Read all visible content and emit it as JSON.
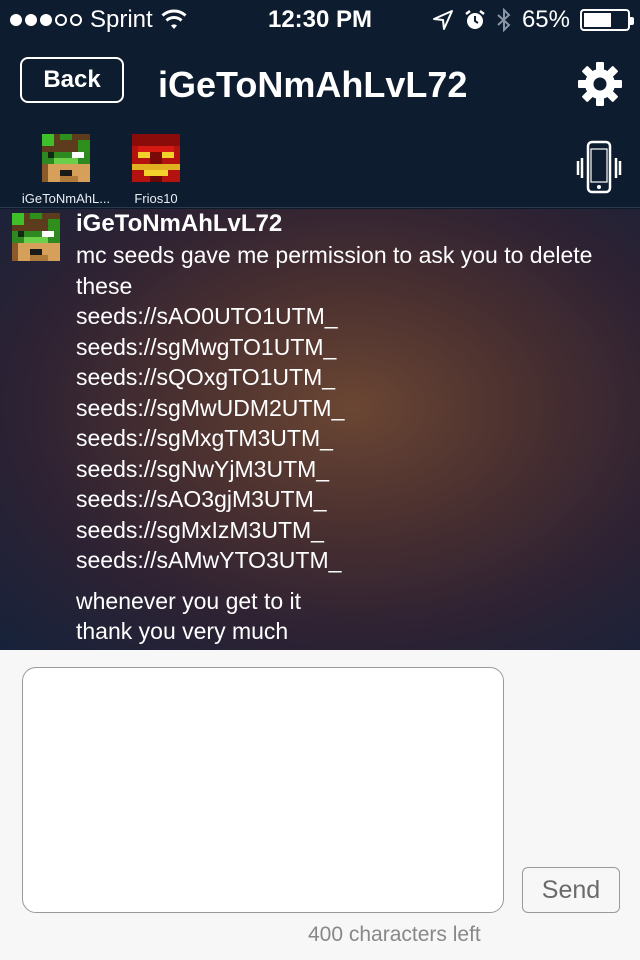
{
  "status_bar": {
    "carrier": "Sprint",
    "signal_bars_filled": 3,
    "signal_bars_total": 5,
    "time": "12:30 PM",
    "battery_percent": "65%",
    "battery_level": 0.65,
    "icons": [
      "wifi-icon",
      "location-arrow-icon",
      "alarm-icon",
      "bluetooth-icon",
      "battery-icon"
    ]
  },
  "nav": {
    "back_label": "Back",
    "title": "iGeToNmAhLvL72",
    "settings_icon": "gear-icon"
  },
  "participants": [
    {
      "name": "iGeToNmAhL...",
      "avatar": "green-creeper-skin-avatar"
    },
    {
      "name": "Frios10",
      "avatar": "red-iron-man-skin-avatar"
    }
  ],
  "vibrate_icon": "vibrate-phone-icon",
  "message": {
    "author": "iGeToNmAhLvL72",
    "lines": [
      "mc seeds gave me permission to ask you to delete",
      "these",
      "seeds://sAO0UTO1UTM_",
      "seeds://sgMwgTO1UTM_",
      "seeds://sQOxgTO1UTM_",
      "seeds://sgMwUDM2UTM_",
      "seeds://sgMxgTM3UTM_",
      "seeds://sgNwYjM3UTM_",
      "seeds://sAO3gjM3UTM_",
      "seeds://sgMxIzM3UTM_",
      "seeds://sAMwYTO3UTM_"
    ],
    "followup_lines": [
      "whenever you get to it",
      "thank you very much"
    ]
  },
  "compose": {
    "input_value": "",
    "send_label": "Send",
    "chars_left": "400 characters left"
  },
  "colors": {
    "bar_background": "#0d1c2e",
    "compose_background": "#f7f7f7",
    "send_text": "#6a6a6a"
  }
}
